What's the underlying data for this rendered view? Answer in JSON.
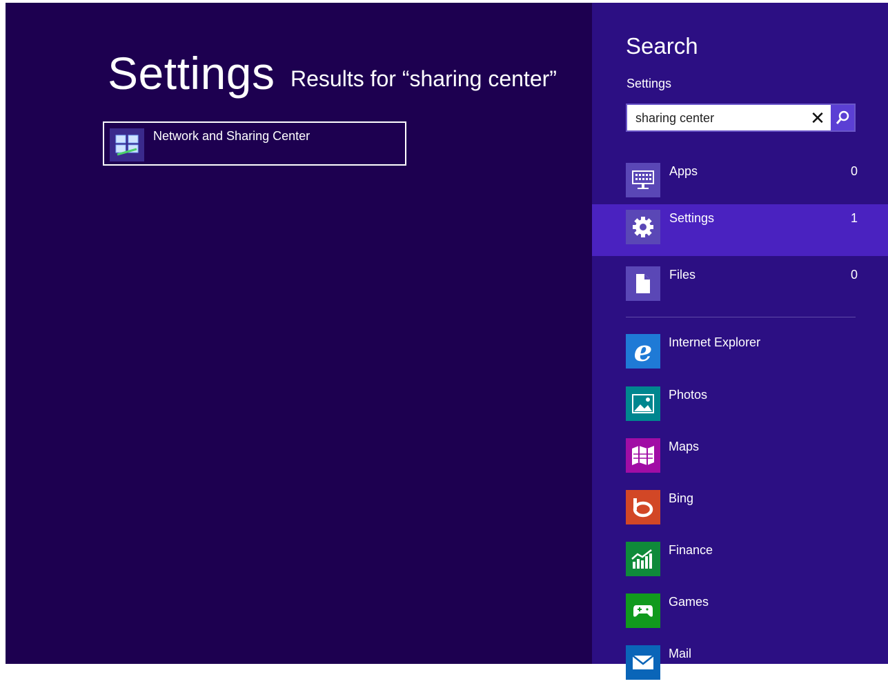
{
  "main": {
    "title": "Settings",
    "subtitle": "Results for “sharing center”",
    "result_label": "Network and Sharing Center"
  },
  "pane": {
    "heading": "Search",
    "scope": "Settings",
    "search_value": "sharing center",
    "filters": [
      {
        "label": "Apps",
        "count": "0",
        "icon": "keyboard-icon"
      },
      {
        "label": "Settings",
        "count": "1",
        "icon": "gear-icon"
      },
      {
        "label": "Files",
        "count": "0",
        "icon": "file-icon"
      }
    ],
    "apps": [
      {
        "label": "Internet Explorer",
        "icon": "internet-explorer-icon",
        "color": "#1f7ad6"
      },
      {
        "label": "Photos",
        "icon": "photos-icon",
        "color": "#00868f"
      },
      {
        "label": "Maps",
        "icon": "maps-icon",
        "color": "#a10da5"
      },
      {
        "label": "Bing",
        "icon": "bing-icon",
        "color": "#d24726"
      },
      {
        "label": "Finance",
        "icon": "finance-icon",
        "color": "#0f8a3a"
      },
      {
        "label": "Games",
        "icon": "games-icon",
        "color": "#119a1d"
      },
      {
        "label": "Mail",
        "icon": "mail-icon",
        "color": "#0a65b8"
      }
    ]
  },
  "colors": {
    "main_bg": "#1d0050",
    "pane_bg": "#2c0f83",
    "selected_bg": "#4a22c0",
    "search_button": "#5b3fd4"
  }
}
